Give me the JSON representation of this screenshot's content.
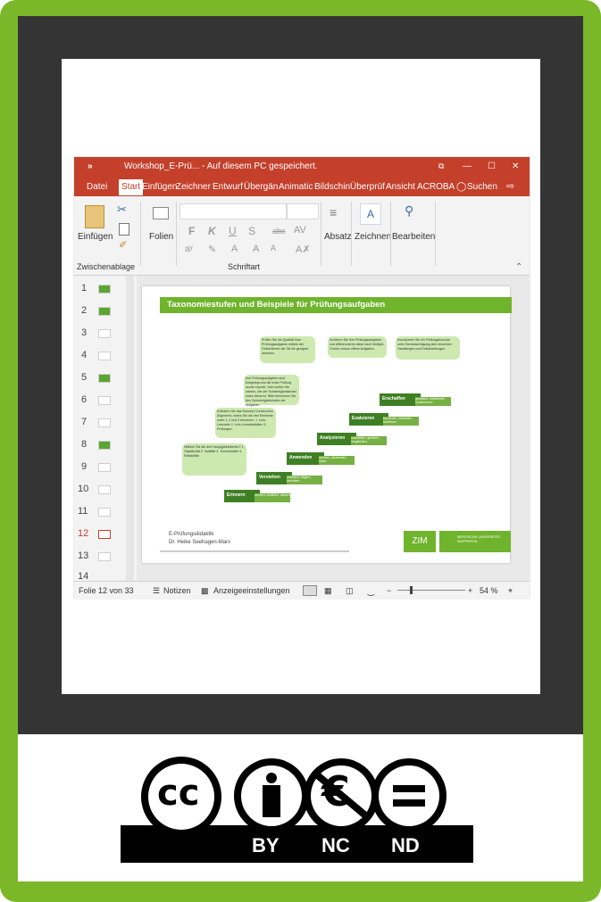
{
  "window": {
    "quick_access": "»",
    "title": "Workshop_E-Prü...  -  Auf diesem PC gespeichert.",
    "controls": {
      "minimize": "—",
      "maximize": "☐",
      "close": "✕",
      "layout": "⧉"
    }
  },
  "ribbon_tabs": [
    "Datei",
    "Start",
    "Einfügen",
    "Zeichner",
    "Entwurf",
    "Übergän",
    "Animatic",
    "Bildschin",
    "Überprüf",
    "Ansicht",
    "ACROBA"
  ],
  "active_tab": "Start",
  "search_label": "Suchen",
  "ribbon": {
    "paste_label": "Einfügen",
    "slides_label": "Folien",
    "clipboard_group": "Zwischenablage",
    "font_group": "Schriftart",
    "paragraph_label": "Absatz",
    "drawing_label": "Zeichnen",
    "editing_label": "Bearbeiten",
    "font_buttons": [
      "F",
      "K",
      "U",
      "S",
      "abc",
      "AV"
    ]
  },
  "thumbnails": [
    "1",
    "2",
    "3",
    "4",
    "5",
    "6",
    "7",
    "8",
    "9",
    "10",
    "11",
    "12",
    "13",
    "14"
  ],
  "current_slide_index": 12,
  "slide": {
    "title": "Taxonomiestufen und Beispiele für Prüfungsaufgaben",
    "steps": [
      "Erinnern",
      "Verstehen",
      "Anwenden",
      "Analysieren",
      "Evaluieren",
      "Erschaffen"
    ],
    "step_sub": [
      "nennen, erzählen, wissen",
      "erläutern, folgern, berichten",
      "wenden, anwenden, lösen",
      "unterteilen, gliedern, vergleichen",
      "beurteilen, bewerten, beweisen",
      "gestalten, entwickeln, konstruieren"
    ],
    "bubbles": [
      "Wählen Sie die drei Hauptgütekriterien? 1. Objektivität 2. Validität 3. Trennschärfe 4. Reliabilität",
      "Erläutern Sie das Konzept Constructive Alignment, indem Sie die drei Elemente unter 1, 2 und 3 benutzen. 1. Lehr-Lernziele 2. Lehr-Lernaktivitäten 3. Prüfungen",
      "Ihre Prüfungsaufgaben sind festgelegt und die erste Prüfung wurde erprobt. Jetzt wollen Sie wissen, wie der Schwierigkeitsindex eines Items ist. Bitte berechnen Sie den Schwierigkeitsindex der Aufgaben.",
      "Prüfen Sie die Qualität Ihrer Prüfungsaufgaben mittels der Gütekriterien die Sie für geeignet ansehen.",
      "Sortieren Sie Ihre Prüfungsaufgaben und differenzieren diese nach Multiple-Choice versus offene Aufgaben.",
      "Konzipieren Sie ein Prüfungskonzept unter Berücksichtigung aller einzelnen Handlungen und Entscheidungen."
    ],
    "footer_line1": "E-Prüfungsdidaktik",
    "footer_line2": "Dr. Heike Seehagen-Marx",
    "logo_zim": "ZIM",
    "logo_uni": "BERGISCHE UNIVERSITÄT WUPPERTAL"
  },
  "statusbar": {
    "slide_info": "Folie 12 von 33",
    "notes": "Notizen",
    "display_settings": "Anzeigeeinstellungen",
    "zoom": "54 %",
    "minus": "−",
    "plus": "+"
  },
  "license": {
    "cc": "cc",
    "by": "BY",
    "nc": "NC",
    "nd": "ND"
  },
  "colors": {
    "frame": "#7ab829",
    "ppt_red": "#c4402b",
    "slide_green": "#6fb42c",
    "step_green": "#3f7f24"
  }
}
